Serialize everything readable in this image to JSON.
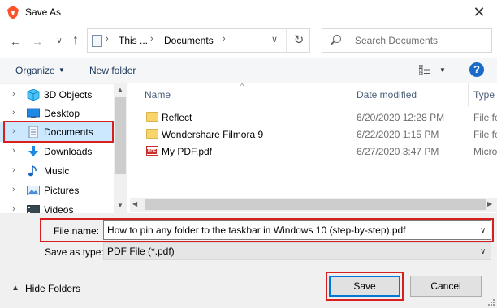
{
  "window": {
    "title": "Save As",
    "close_glyph": "✕"
  },
  "address": {
    "segments": [
      "This ...",
      "Documents"
    ],
    "separator": "›",
    "search_placeholder": "Search Documents"
  },
  "toolbar": {
    "organize": "Organize",
    "new_folder": "New folder",
    "help": "?"
  },
  "nav": {
    "items": [
      {
        "label": "3D Objects",
        "icon": "3d-objects-icon"
      },
      {
        "label": "Desktop",
        "icon": "desktop-icon"
      },
      {
        "label": "Documents",
        "icon": "documents-icon",
        "selected": true
      },
      {
        "label": "Downloads",
        "icon": "downloads-icon"
      },
      {
        "label": "Music",
        "icon": "music-icon"
      },
      {
        "label": "Pictures",
        "icon": "pictures-icon"
      },
      {
        "label": "Videos",
        "icon": "videos-icon"
      }
    ]
  },
  "columns": {
    "name": "Name",
    "date": "Date modified",
    "type": "Type"
  },
  "files": [
    {
      "name": "Reflect",
      "date": "6/20/2020 12:28 PM",
      "type": "File fo",
      "icon": "folder-icon"
    },
    {
      "name": "Wondershare Filmora 9",
      "date": "6/22/2020 1:15 PM",
      "type": "File fo",
      "icon": "folder-icon"
    },
    {
      "name": "My PDF.pdf",
      "date": "6/27/2020 3:47 PM",
      "type": "Micro",
      "icon": "pdf-icon"
    }
  ],
  "form": {
    "file_name_label": "File name:",
    "file_name_value": "How to pin any folder to the taskbar in Windows 10 (step-by-step).pdf",
    "save_type_label": "Save as type:",
    "save_type_value": "PDF File (*.pdf)"
  },
  "footer": {
    "hide_folders": "Hide Folders",
    "save": "Save",
    "cancel": "Cancel"
  },
  "colors": {
    "accent": "#0078d7",
    "highlight": "#d62020",
    "selected": "#cce8ff",
    "brave": "#fb542b"
  }
}
